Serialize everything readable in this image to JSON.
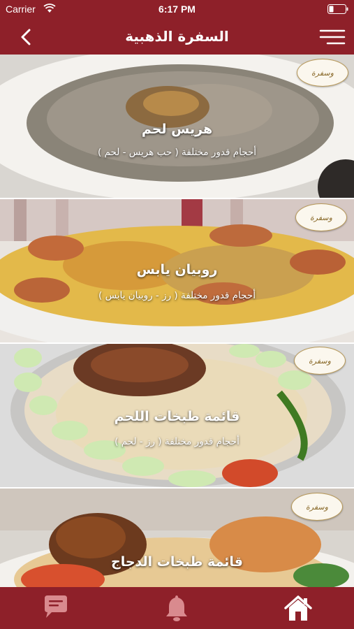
{
  "status_bar": {
    "carrier": "Carrier",
    "time": "6:17 PM"
  },
  "nav": {
    "title": "السفرة الذهبية"
  },
  "logo_text": "وسفرة",
  "items": [
    {
      "title": "هريس لحم",
      "subtitle": "أحجام قدور مختلفة ( حب هريس - لحم )"
    },
    {
      "title": "روبيان يابس",
      "subtitle": "أحجام قدور مختلفة ( رز - روبيان يابس )"
    },
    {
      "title": "قائمة طبخات اللحم",
      "subtitle": "أحجام قدور مختلفة ( رز - لحم )"
    },
    {
      "title": "قائمة طبخات الدجاج",
      "subtitle": ""
    }
  ],
  "tabs": [
    {
      "name": "chat-icon"
    },
    {
      "name": "bell-icon"
    },
    {
      "name": "home-icon"
    }
  ],
  "colors": {
    "primary": "#8e2029",
    "icon_muted": "#d98a8e",
    "icon_active": "#ffffff"
  }
}
